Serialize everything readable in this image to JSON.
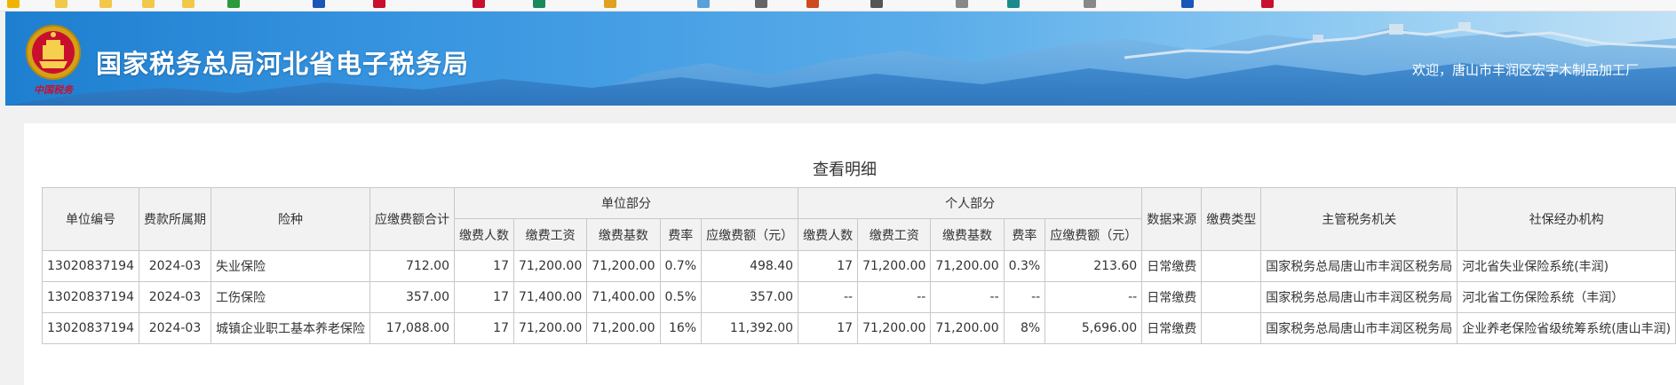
{
  "header": {
    "title": "国家税务总局河北省电子税务局",
    "welcome": "欢迎，唐山市丰润区宏宇木制品加工厂",
    "emblem_text": "中国税务"
  },
  "colors": {
    "banner_start": "#1e7fd0",
    "banner_end": "#9fd1f1",
    "table_header_bg": "#f2f2f2",
    "table_border": "#c8c8c8"
  },
  "page": {
    "title": "查看明细"
  },
  "table": {
    "headers": {
      "unit_code": "单位编号",
      "period": "费款所属期",
      "insurance_type": "险种",
      "total_payable": "应缴费额合计",
      "unit_part": "单位部分",
      "personal_part": "个人部分",
      "data_source": "数据来源",
      "fee_type": "缴费类型",
      "tax_authority": "主管税务机关",
      "social_agency": "社保经办机构"
    },
    "sub_headers": {
      "count": "缴费人数",
      "wage": "缴费工资",
      "base": "缴费基数",
      "rate": "费率",
      "amount": "应缴费额（元）"
    },
    "rows": [
      {
        "unit_code": "13020837194",
        "period": "2024-03",
        "insurance_type": "失业保险",
        "total_payable": "712.00",
        "unit_count": "17",
        "unit_wage": "71,200.00",
        "unit_base": "71,200.00",
        "unit_rate": "0.7%",
        "unit_amount": "498.40",
        "personal_count": "17",
        "personal_wage": "71,200.00",
        "personal_base": "71,200.00",
        "personal_rate": "0.3%",
        "personal_amount": "213.60",
        "data_source": "日常缴费",
        "fee_type": "",
        "tax_authority": "国家税务总局唐山市丰润区税务局",
        "social_agency": "河北省失业保险系统(丰润)"
      },
      {
        "unit_code": "13020837194",
        "period": "2024-03",
        "insurance_type": "工伤保险",
        "total_payable": "357.00",
        "unit_count": "17",
        "unit_wage": "71,400.00",
        "unit_base": "71,400.00",
        "unit_rate": "0.5%",
        "unit_amount": "357.00",
        "personal_count": "--",
        "personal_wage": "--",
        "personal_base": "--",
        "personal_rate": "--",
        "personal_amount": "--",
        "data_source": "日常缴费",
        "fee_type": "",
        "tax_authority": "国家税务总局唐山市丰润区税务局",
        "social_agency": "河北省工伤保险系统（丰润）"
      },
      {
        "unit_code": "13020837194",
        "period": "2024-03",
        "insurance_type": "城镇企业职工基本养老保险",
        "total_payable": "17,088.00",
        "unit_count": "17",
        "unit_wage": "71,200.00",
        "unit_base": "71,200.00",
        "unit_rate": "16%",
        "unit_amount": "11,392.00",
        "personal_count": "17",
        "personal_wage": "71,200.00",
        "personal_base": "71,200.00",
        "personal_rate": "8%",
        "personal_amount": "5,696.00",
        "data_source": "日常缴费",
        "fee_type": "",
        "tax_authority": "国家税务总局唐山市丰润区税务局",
        "social_agency": "企业养老保险省级统筹系统(唐山丰润)"
      }
    ]
  }
}
